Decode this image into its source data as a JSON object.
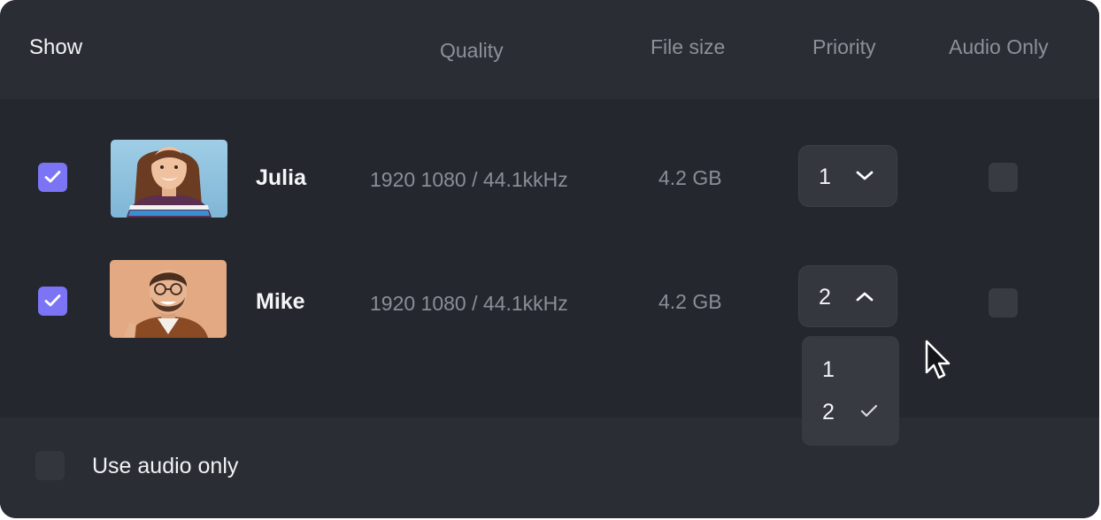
{
  "header": {
    "show": "Show",
    "quality": "Quality",
    "file_size": "File size",
    "priority": "Priority",
    "audio_only": "Audio Only"
  },
  "rows": [
    {
      "name": "Julia",
      "quality": "1920 1080 / 44.1kkHz",
      "file_size": "4.2 GB",
      "priority": "1",
      "priority_icon": "chevron-down-icon",
      "show_checked": true,
      "audio_only_checked": false
    },
    {
      "name": "Mike",
      "quality": "1920 1080 / 44.1kkHz",
      "file_size": "4.2 GB",
      "priority": "2",
      "priority_icon": "chevron-up-icon",
      "show_checked": true,
      "audio_only_checked": false
    }
  ],
  "priority_menu": {
    "options": [
      "1",
      "2"
    ],
    "selected": "2"
  },
  "footer": {
    "use_audio_only_label": "Use audio only",
    "use_audio_only_checked": false
  },
  "colors": {
    "panel_bg": "#24272e",
    "header_bg": "#2a2d34",
    "accent_checkbox": "#7b74f5",
    "muted_text": "#8a8e96",
    "primary_text": "#f2f3f5"
  }
}
